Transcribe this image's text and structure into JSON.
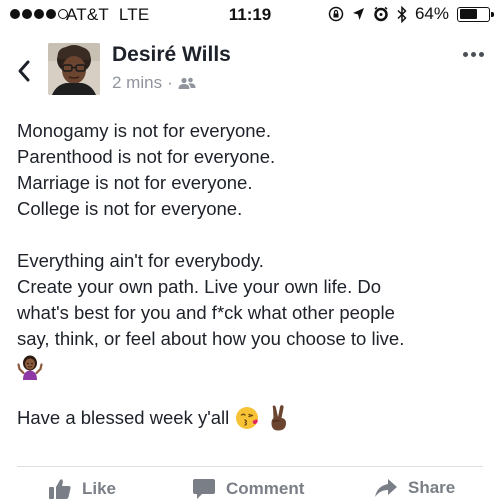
{
  "status_bar": {
    "carrier": "AT&T",
    "network": "LTE",
    "time": "11:19",
    "battery_percent": "64%",
    "battery_level": 0.64,
    "icons": [
      "signal-dots-icon",
      "rotation-lock-icon",
      "location-arrow-icon",
      "alarm-clock-icon",
      "bluetooth-icon",
      "battery-icon"
    ]
  },
  "post": {
    "author": "Desiré Wills",
    "timestamp": "2 mins",
    "separator": "·",
    "privacy_icon": "friends-icon",
    "body_paragraph_1": [
      "Monogamy is not for everyone.",
      "Parenthood is not for everyone.",
      "Marriage is not for everyone.",
      "College is not for everyone."
    ],
    "body_paragraph_2": [
      "Everything ain't for everybody.",
      "Create your own path. Live your own life. Do",
      "what's best for you and f*ck what other people",
      "say, think, or feel about how you choose to live."
    ],
    "emoji_shrug": "woman-shrugging-emoji",
    "closing_text": "Have a blessed week y'all",
    "closing_emojis": [
      "face-blowing-kiss-emoji",
      "victory-hand-emoji"
    ]
  },
  "actions": {
    "like": "Like",
    "comment": "Comment",
    "share": "Share"
  },
  "colors": {
    "text": "#1d2129",
    "meta": "#90949c",
    "action": "#7a7f87",
    "divider": "#dddfe2"
  }
}
